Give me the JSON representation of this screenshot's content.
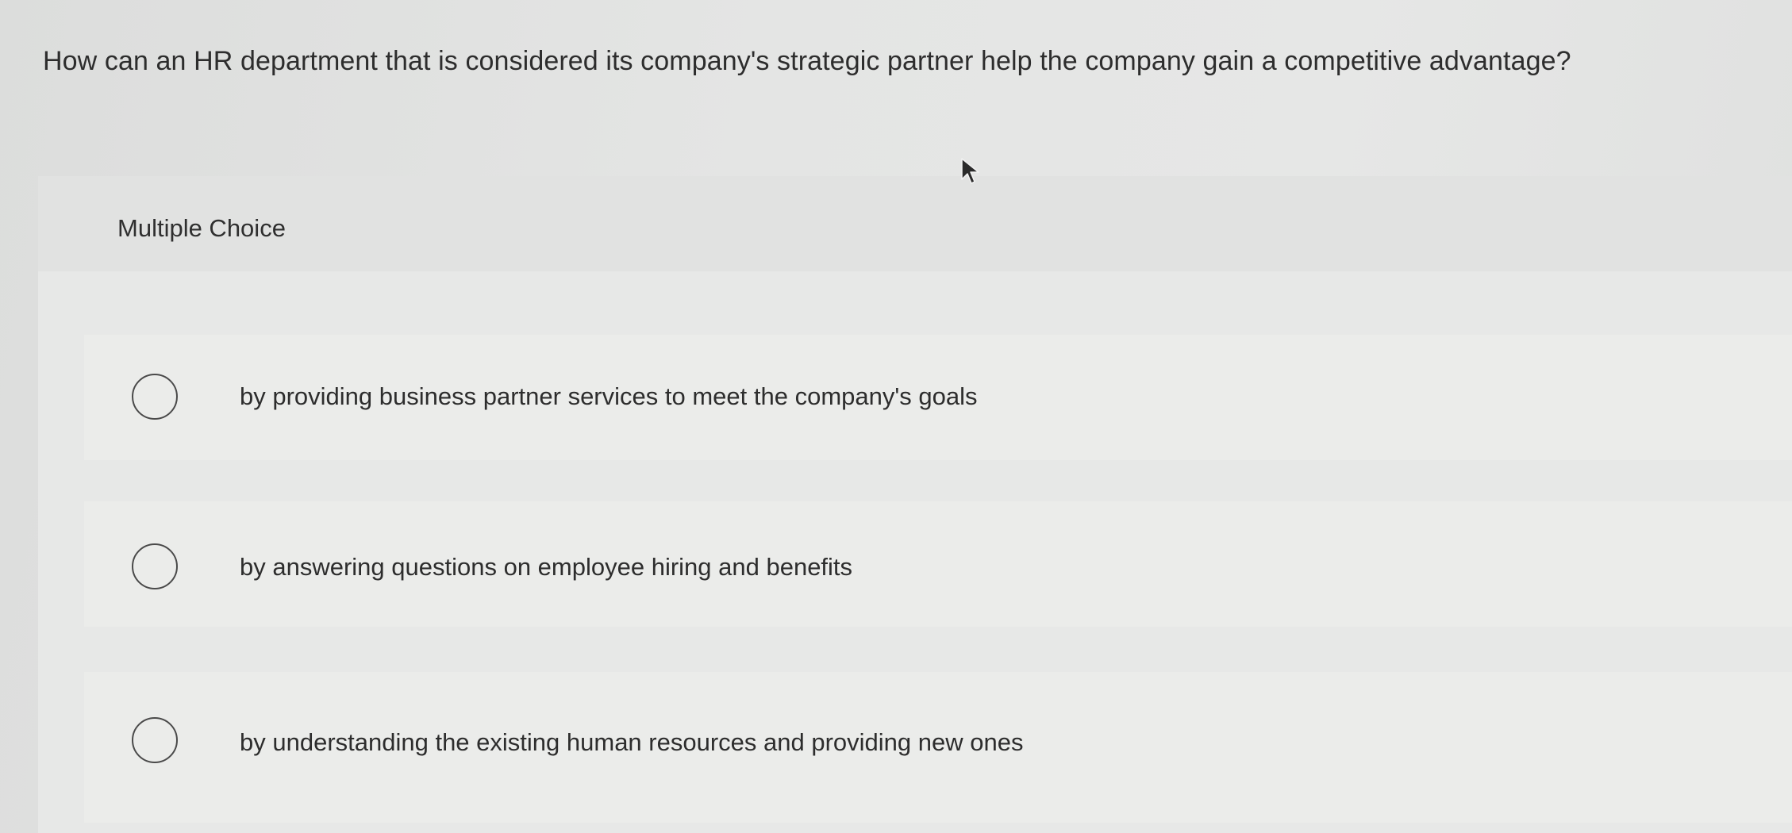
{
  "question": {
    "text": "How can an HR department that is considered its company's strategic partner help the company gain a competitive advantage?"
  },
  "answer_panel": {
    "type_label": "Multiple Choice",
    "options": [
      {
        "label": "by providing business partner services to meet the company's goals",
        "selected": false
      },
      {
        "label": "by answering questions on employee hiring and benefits",
        "selected": false
      },
      {
        "label": "by understanding the existing human resources and providing new ones",
        "selected": false
      }
    ]
  },
  "icons": {
    "pointer": "mouse-cursor-icon",
    "radio": "radio-button-icon"
  },
  "colors": {
    "background": "#e3e4e3",
    "text": "#2d2d2d",
    "radio_border": "#4a4a4a"
  }
}
